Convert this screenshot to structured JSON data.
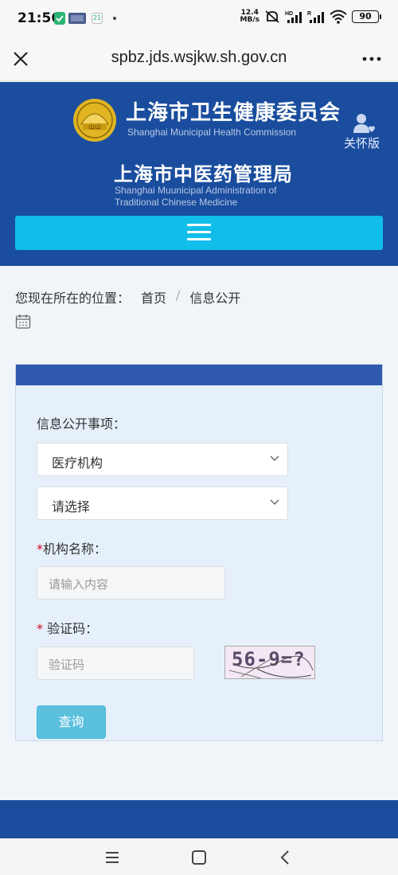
{
  "status_bar": {
    "time": "21:56",
    "notification_date": "21",
    "net_speed_value": "12.4",
    "net_speed_unit": "MB/s",
    "signal_label_1": "HD",
    "signal_label_2": "R",
    "battery": "90"
  },
  "browser": {
    "url": "spbz.jds.wsjkw.sh.gov.cn"
  },
  "header": {
    "emblem_text": "山山",
    "org_name_cn": "上海市卫生健康委员会",
    "org_name_en": "Shanghai Municipal Health Commission",
    "care_mode_label": "关怀版",
    "sub_org_cn": "上海市中医药管理局",
    "sub_org_en_line1": "Shanghai Muunicipal Administration of",
    "sub_org_en_line2": "Traditional Chinese Medicine"
  },
  "breadcrumb": {
    "prefix": "您现在所在的位置：",
    "home": "首页",
    "separator": "/",
    "current": "信息公开"
  },
  "form": {
    "section_label": "信息公开事项：",
    "select_category_value": "医疗机构",
    "select_sub_value": "请选择",
    "required_mark": "*",
    "org_name_label": "机构名称：",
    "org_name_placeholder": "请输入内容",
    "captcha_label": " 验证码：",
    "captcha_placeholder": "验证码",
    "captcha_text": "56-9=?",
    "submit_label": "查询"
  },
  "colors": {
    "header_bg": "#1a4d9e",
    "menu_bar": "#10bee9",
    "panel_head": "#2f59ad",
    "query_button": "#5bc0de",
    "required": "#d0021b"
  }
}
